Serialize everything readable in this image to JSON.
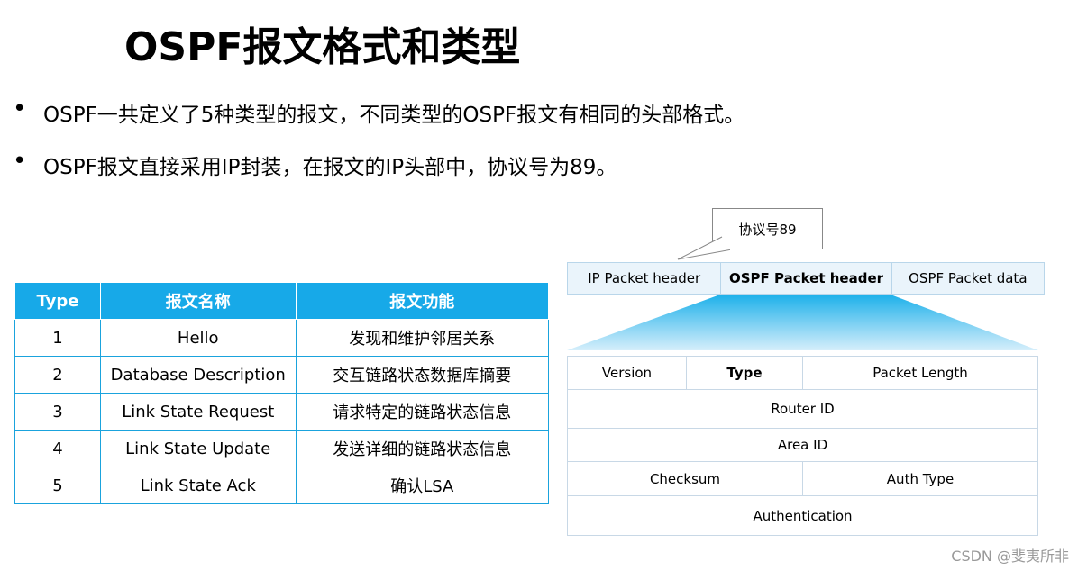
{
  "title": "OSPF报文格式和类型",
  "bullets": [
    "OSPF一共定义了5种类型的报文，不同类型的OSPF报文有相同的头部格式。",
    "OSPF报文直接采用IP封装，在报文的IP头部中，协议号为89。"
  ],
  "bullet_symbol": "•",
  "type_table": {
    "headers": [
      "Type",
      "报文名称",
      "报文功能"
    ],
    "rows": [
      [
        "1",
        "Hello",
        "发现和维护邻居关系"
      ],
      [
        "2",
        "Database Description",
        "交互链路状态数据库摘要"
      ],
      [
        "3",
        "Link State Request",
        "请求特定的链路状态信息"
      ],
      [
        "4",
        "Link State Update",
        "发送详细的链路状态信息"
      ],
      [
        "5",
        "Link State Ack",
        "确认LSA"
      ]
    ]
  },
  "callout": "协议号89",
  "packet": {
    "ip_header": "IP Packet header",
    "ospf_header": "OSPF Packet header",
    "ospf_data": "OSPF Packet data"
  },
  "header_fields": {
    "version": "Version",
    "type": "Type",
    "packet_length": "Packet Length",
    "router_id": "Router ID",
    "area_id": "Area ID",
    "checksum": "Checksum",
    "auth_type": "Auth Type",
    "authentication": "Authentication"
  },
  "watermark": "CSDN @斐夷所非",
  "colors": {
    "table_header": "#17a9e8",
    "table_border": "#1aa3dd",
    "packet_fill": "#eaf4fb",
    "trapezoid_top": "#1db0ea",
    "trapezoid_bottom": "#d6eefb"
  }
}
